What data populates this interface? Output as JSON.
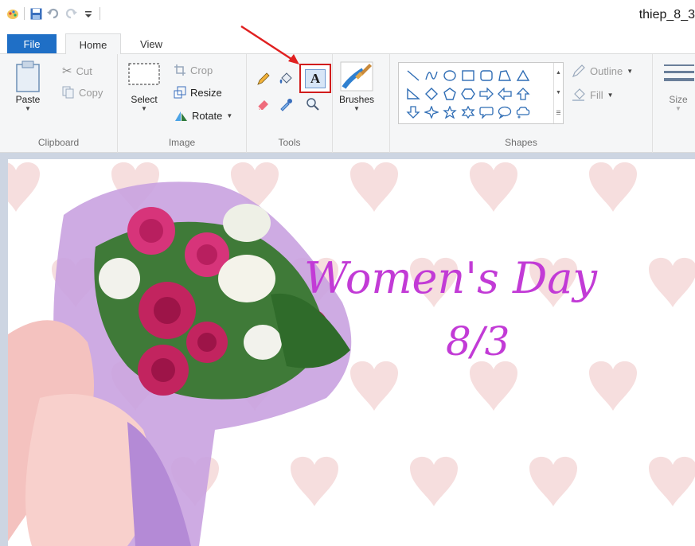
{
  "window": {
    "title": "thiep_8_3"
  },
  "tabs": {
    "file": "File",
    "home": "Home",
    "view": "View"
  },
  "clipboard": {
    "paste": "Paste",
    "cut": "Cut",
    "copy": "Copy",
    "label": "Clipboard"
  },
  "image": {
    "select": "Select",
    "crop": "Crop",
    "resize": "Resize",
    "rotate": "Rotate",
    "label": "Image"
  },
  "tools": {
    "label": "Tools",
    "text_tool_glyph": "A"
  },
  "brushes": {
    "label": "Brushes"
  },
  "shapes": {
    "outline": "Outline",
    "fill": "Fill",
    "label": "Shapes"
  },
  "size": {
    "label": "Size"
  },
  "canvas": {
    "line1": "Women's Day",
    "line2": "8/3"
  },
  "colors": {
    "file_tab": "#1f6fc6",
    "highlight": "#d11c1c",
    "text_color": "#c23bd6",
    "heart": "#f6dede"
  }
}
